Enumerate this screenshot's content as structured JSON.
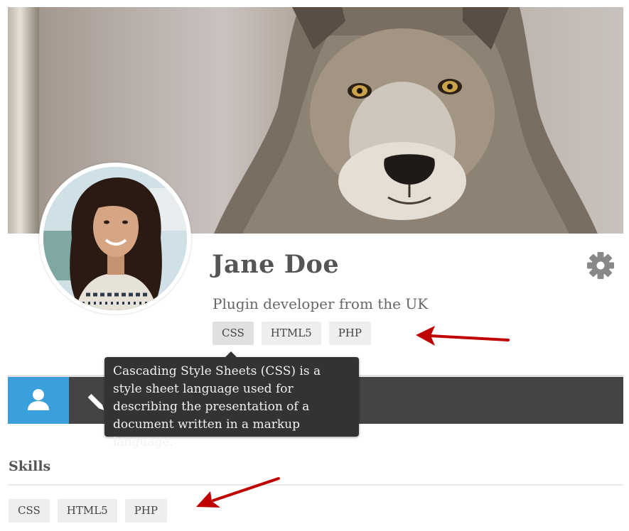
{
  "profile": {
    "name": "Jane Doe",
    "tagline": "Plugin developer from the UK",
    "tags": [
      "CSS",
      "HTML5",
      "PHP"
    ]
  },
  "tooltip": {
    "text": "Cascading Style Sheets (CSS) is a style sheet language used for describing the presentation of a document written in a markup language."
  },
  "skills": {
    "title": "Skills",
    "items": [
      "CSS",
      "HTML5",
      "PHP"
    ]
  },
  "icons": {
    "settings": "gear-icon",
    "profile_tab": "user-icon",
    "edit_tab": "pencil-icon"
  },
  "colors": {
    "accent": "#3aa0db",
    "navbar": "#444444",
    "tooltip_bg": "#333333",
    "tag_bg": "#eeeeee",
    "annotation_arrow": "#c00000"
  }
}
